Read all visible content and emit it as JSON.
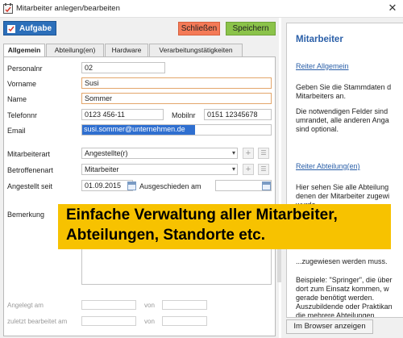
{
  "window": {
    "title": "Mitarbeiter anlegen/bearbeiten",
    "close_glyph": "✕"
  },
  "toolbar": {
    "task_label": "Aufgabe",
    "close_label": "Schließen",
    "save_label": "Speichern"
  },
  "tabs": [
    {
      "label": "Allgemein",
      "active": true
    },
    {
      "label": "Abteilung(en)",
      "active": false
    },
    {
      "label": "Hardware",
      "active": false
    },
    {
      "label": "Verarbeitungstätigkeiten",
      "active": false
    }
  ],
  "form": {
    "personalnr": {
      "label": "Personalnr",
      "value": "02"
    },
    "vorname": {
      "label": "Vorname",
      "value": "Susi"
    },
    "name": {
      "label": "Name",
      "value": "Sommer"
    },
    "telefon": {
      "label": "Telefonnr",
      "value": "0123 456-11"
    },
    "mobil": {
      "label": "Mobilnr",
      "value": "0151 12345678"
    },
    "email": {
      "label": "Email",
      "value": "susi.sommer@unternehmen.de"
    },
    "mitarbeiterart": {
      "label": "Mitarbeiterart",
      "value": "Angestellte(r)"
    },
    "betroffenenart": {
      "label": "Betroffenenart",
      "value": "Mitarbeiter"
    },
    "angestellt": {
      "label": "Angestellt seit",
      "value": "01.09.2015"
    },
    "ausgeschieden": {
      "label": "Ausgeschieden am",
      "value": ""
    },
    "bemerkung": {
      "label": "Bemerkung"
    },
    "angelegt": {
      "label": "Angelegt am",
      "von_label": "von"
    },
    "bearbeitet": {
      "label": "zuletzt bearbeitet am",
      "von_label": "von"
    }
  },
  "banner": {
    "line1": "Einfache Verwaltung aller Mitarbeiter,",
    "line2": "Abteilungen, Standorte etc."
  },
  "help": {
    "title": "Mitarbeiter",
    "link_general": "Reiter Allgemein",
    "p1": [
      "Geben Sie die Stammdaten d",
      "Mitarbeiters an."
    ],
    "p2": [
      "Die notwendigen Felder sind",
      "umrandet, alle anderen Anga",
      "sind optional."
    ],
    "link_dept": "Reiter Abteilung(en)",
    "p3": [
      "Hier sehen Sie alle Abteilung",
      "denen der Mitarbeiter zugewi",
      "wurde."
    ],
    "p3_hidden_tail": [
      "...zugewiesen werden muss."
    ],
    "p4": [
      "Beispiele: \"Springer\", die über",
      "dort zum Einsatz kommen, w",
      "gerade benötigt werden.",
      "Auszubildende oder Praktikan",
      "die mehrere Abteilungen"
    ],
    "browser_button": "Im Browser anzeigen"
  },
  "icons": {
    "dropdown": "▾",
    "add": "+",
    "list": "☰"
  }
}
